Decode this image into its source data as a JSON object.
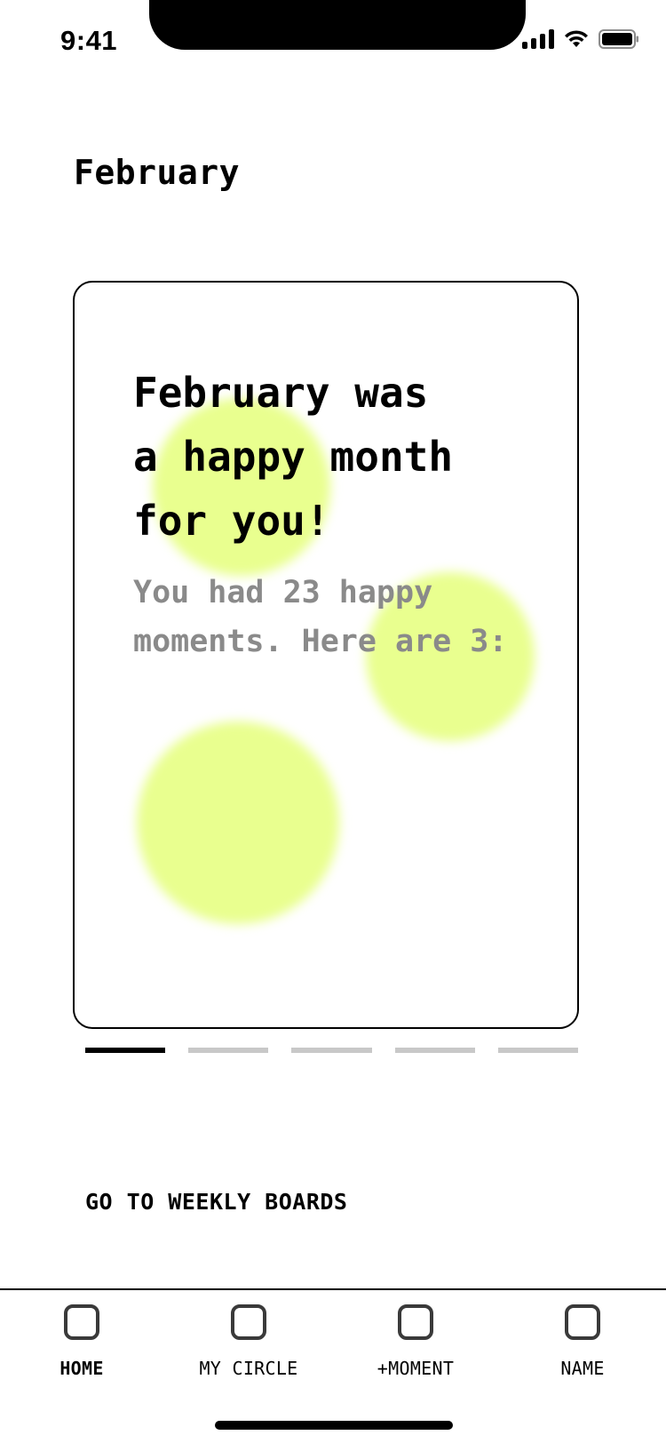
{
  "status_bar": {
    "time": "9:41",
    "icons": [
      "signal-icon",
      "wifi-icon",
      "battery-icon"
    ]
  },
  "header": {
    "title": "February"
  },
  "card": {
    "headline": "February was\na happy month\nfor you!",
    "subtext": "You had 23 happy\nmoments. Here are 3:",
    "accent_color": "#e9ff8f"
  },
  "progress": {
    "total_segments": 5,
    "active_index": 0
  },
  "links": {
    "weekly_boards": "GO TO WEEKLY BOARDS"
  },
  "tab_bar": {
    "items": [
      {
        "label": "HOME",
        "active": true
      },
      {
        "label": "MY CIRCLE",
        "active": false
      },
      {
        "label": "+MOMENT",
        "active": false
      },
      {
        "label": "NAME",
        "active": false
      }
    ]
  }
}
